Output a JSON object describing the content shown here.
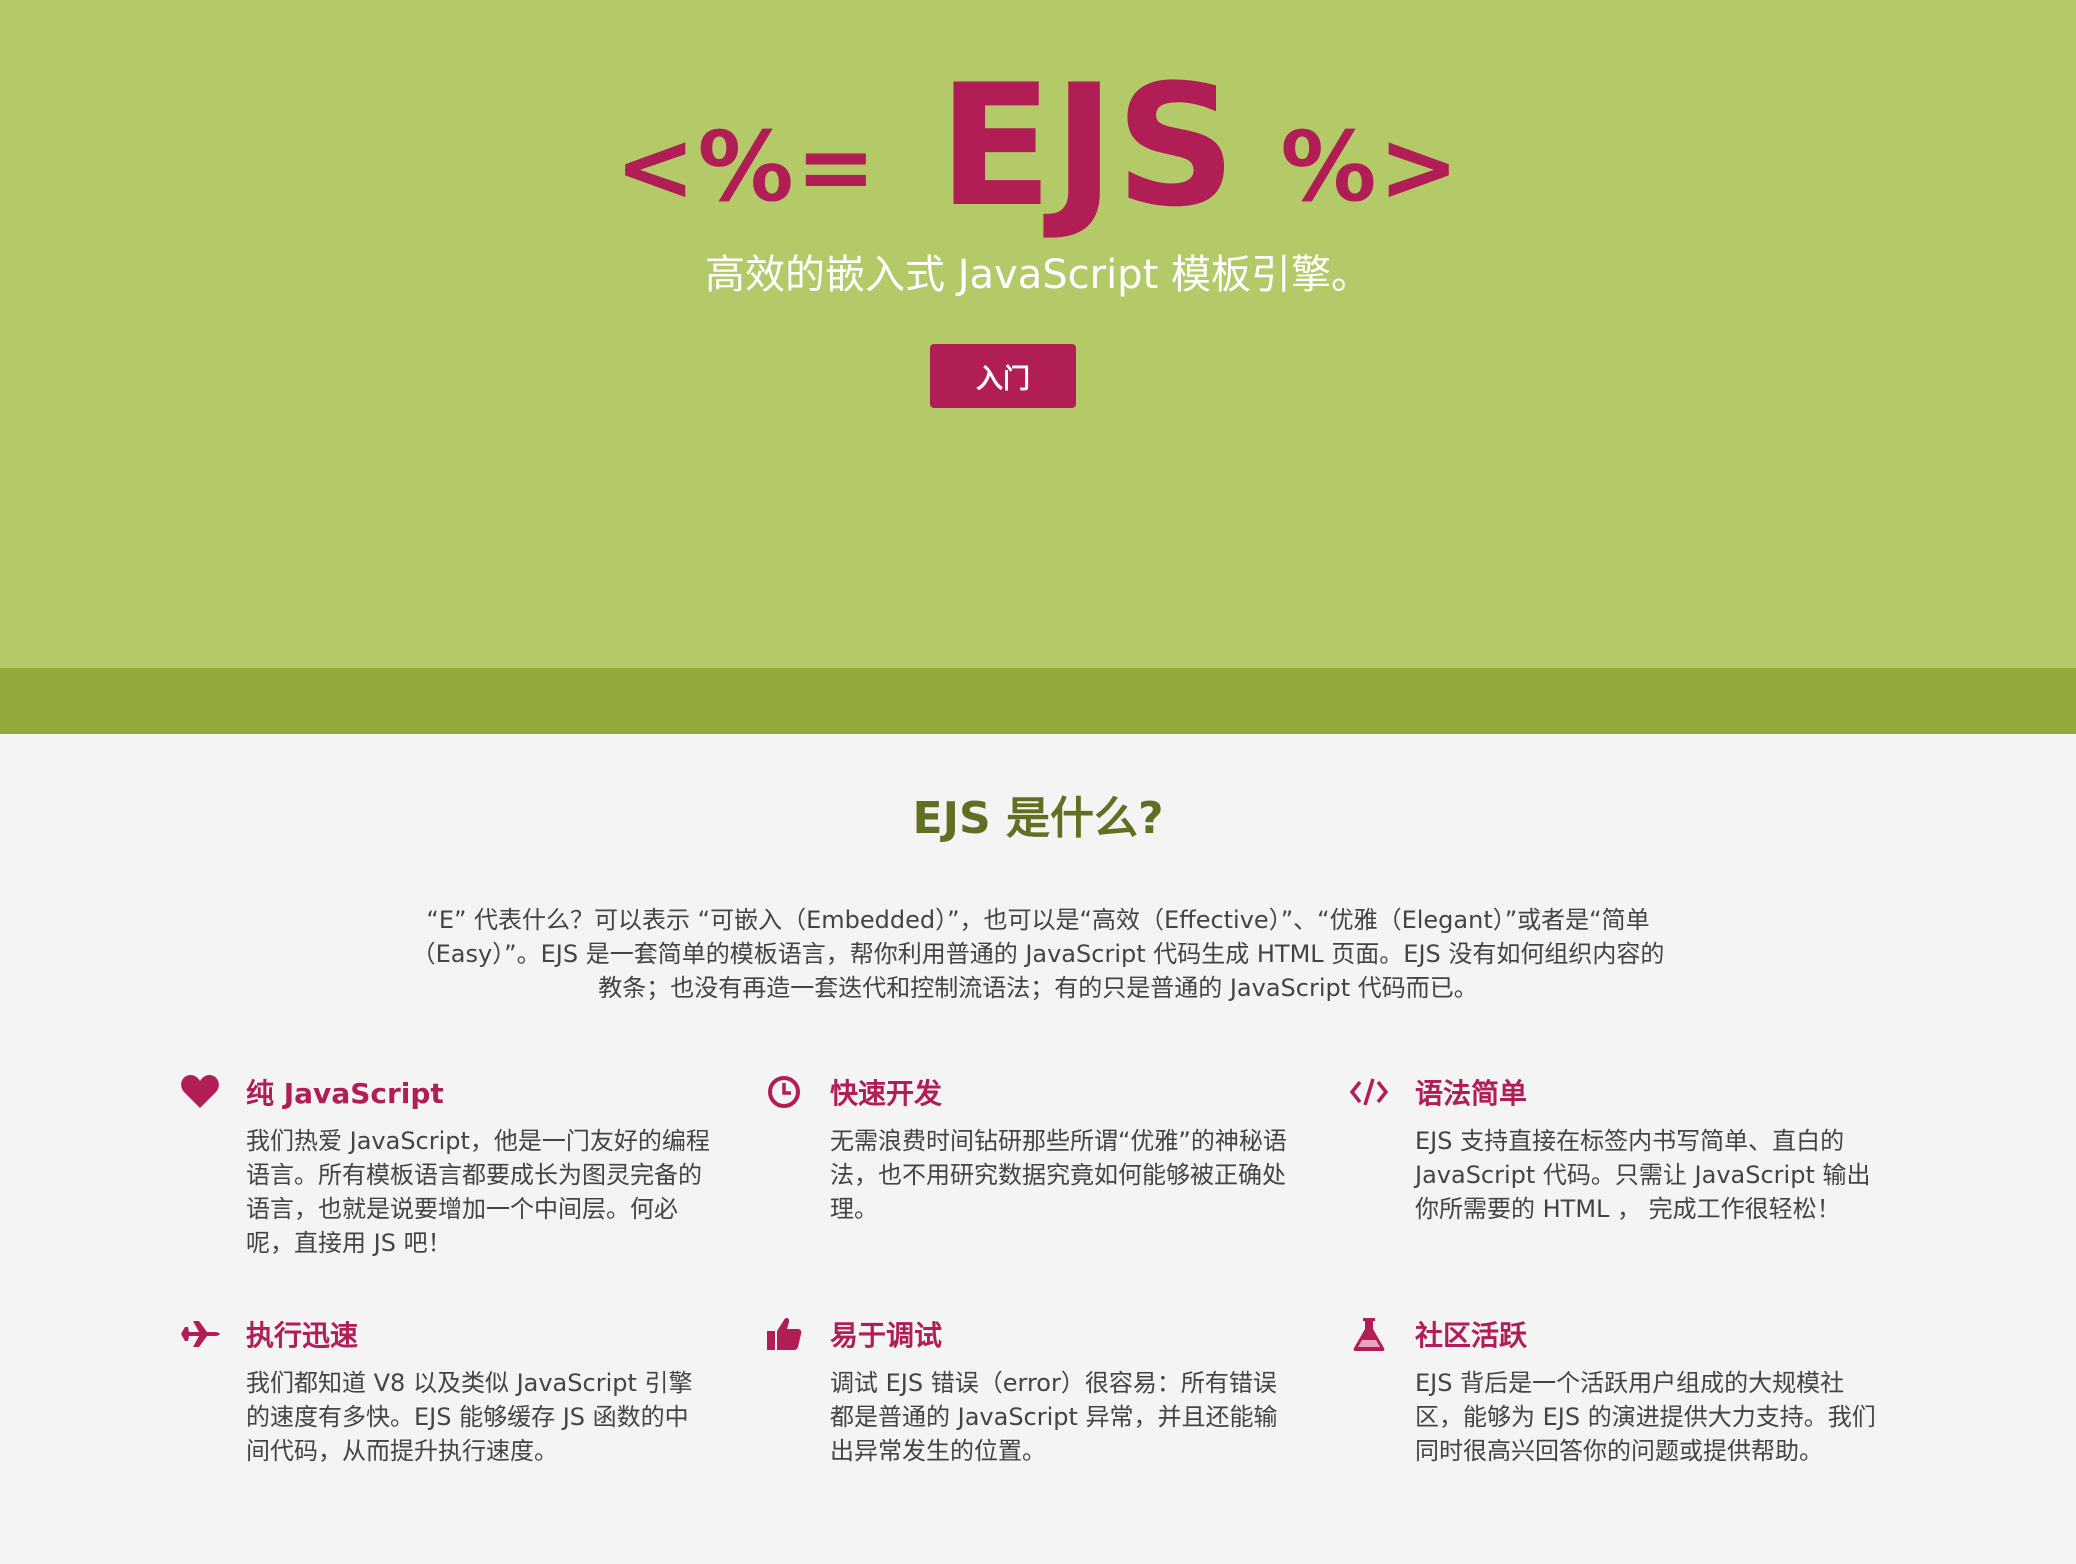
{
  "hero": {
    "logo_open": "<%=",
    "logo_main": "EJS",
    "logo_close": "%>",
    "subtitle": "高效的嵌入式 JavaScript 模板引擎。",
    "cta_label": "入门"
  },
  "about": {
    "title": "EJS 是什么?",
    "text": "“E” 代表什么？可以表示 “可嵌入（Embedded）”，也可以是“高效（Effective）”、“优雅（Elegant）”或者是“简单（Easy）”。EJS 是一套简单的模板语言，帮你利用普通的 JavaScript 代码生成 HTML 页面。EJS 没有如何组织内容的教条；也没有再造一套迭代和控制流语法；有的只是普通的 JavaScript 代码而已。"
  },
  "features": [
    {
      "icon": "heart-icon",
      "title": "纯 JavaScript",
      "text": "我们热爱 JavaScript，他是一门友好的编程语言。所有模板语言都要成长为图灵完备的语言，也就是说要增加一个中间层。何必呢，直接用 JS 吧！"
    },
    {
      "icon": "clock-icon",
      "title": "快速开发",
      "text": "无需浪费时间钻研那些所谓“优雅”的神秘语法，也不用研究数据究竟如何能够被正确处理。"
    },
    {
      "icon": "code-icon",
      "title": "语法简单",
      "text": "EJS 支持直接在标签内书写简单、直白的 JavaScript 代码。只需让 JavaScript 输出你所需要的 HTML ， 完成工作很轻松！"
    },
    {
      "icon": "plane-icon",
      "title": "执行迅速",
      "text": "我们都知道 V8 以及类似 JavaScript 引擎的速度有多快。EJS 能够缓存 JS 函数的中间代码，从而提升执行速度。"
    },
    {
      "icon": "thumbs-up-icon",
      "title": "易于调试",
      "text": "调试 EJS 错误（error）很容易：所有错误都是普通的 JavaScript 异常，并且还能输出异常发生的位置。"
    },
    {
      "icon": "flask-icon",
      "title": "社区活跃",
      "text": "EJS 背后是一个活跃用户组成的大规模社区，能够为 EJS 的演进提供大力支持。我们同时很高兴回答你的问题或提供帮助。"
    }
  ],
  "colors": {
    "hero_bg": "#b4ca69",
    "hero_band": "#92aa3b",
    "accent": "#b11d55",
    "heading_green": "#5f7023",
    "page_bg": "#f4f4f4"
  }
}
